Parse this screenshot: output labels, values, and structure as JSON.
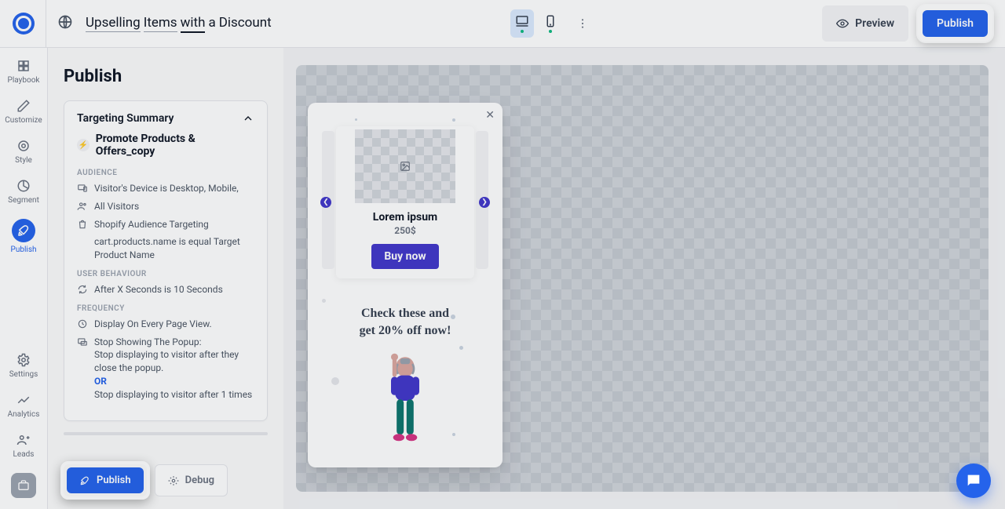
{
  "topbar": {
    "title_parts": [
      "Upselling",
      "Items",
      "with",
      "a",
      "Discount"
    ],
    "preview_label": "Preview",
    "publish_label": "Publish"
  },
  "rail": {
    "items": [
      {
        "label": "Playbook"
      },
      {
        "label": "Customize"
      },
      {
        "label": "Style"
      },
      {
        "label": "Segment"
      },
      {
        "label": "Publish"
      },
      {
        "label": "Settings"
      },
      {
        "label": "Analytics"
      },
      {
        "label": "Leads"
      }
    ]
  },
  "panel": {
    "title": "Publish",
    "card_header": "Targeting Summary",
    "promote_title": "Promote Products & Offers_copy",
    "sections": {
      "audience_label": "AUDIENCE",
      "audience_1": "Visitor's Device is Desktop, Mobile,",
      "audience_2": "All Visitors",
      "audience_3": "Shopify Audience Targeting",
      "audience_3_sub": "cart.products.name is equal Target Product Name",
      "behaviour_label": "USER BEHAVIOUR",
      "behaviour_1": "After X Seconds is 10 Seconds",
      "frequency_label": "FREQUENCY",
      "frequency_1": "Display On Every Page View.",
      "frequency_2_head": "Stop Showing The Popup:",
      "frequency_2_a": "Stop displaying to visitor after they close the popup.",
      "frequency_or": "OR",
      "frequency_2_b": "Stop displaying to visitor after 1 times"
    },
    "footer": {
      "publish": "Publish",
      "debug": "Debug"
    }
  },
  "popup": {
    "product_title": "Lorem ipsum",
    "product_price": "250$",
    "buy_label": "Buy now",
    "headline_l1": "Check these and",
    "headline_l2": "get 20% off now!"
  }
}
